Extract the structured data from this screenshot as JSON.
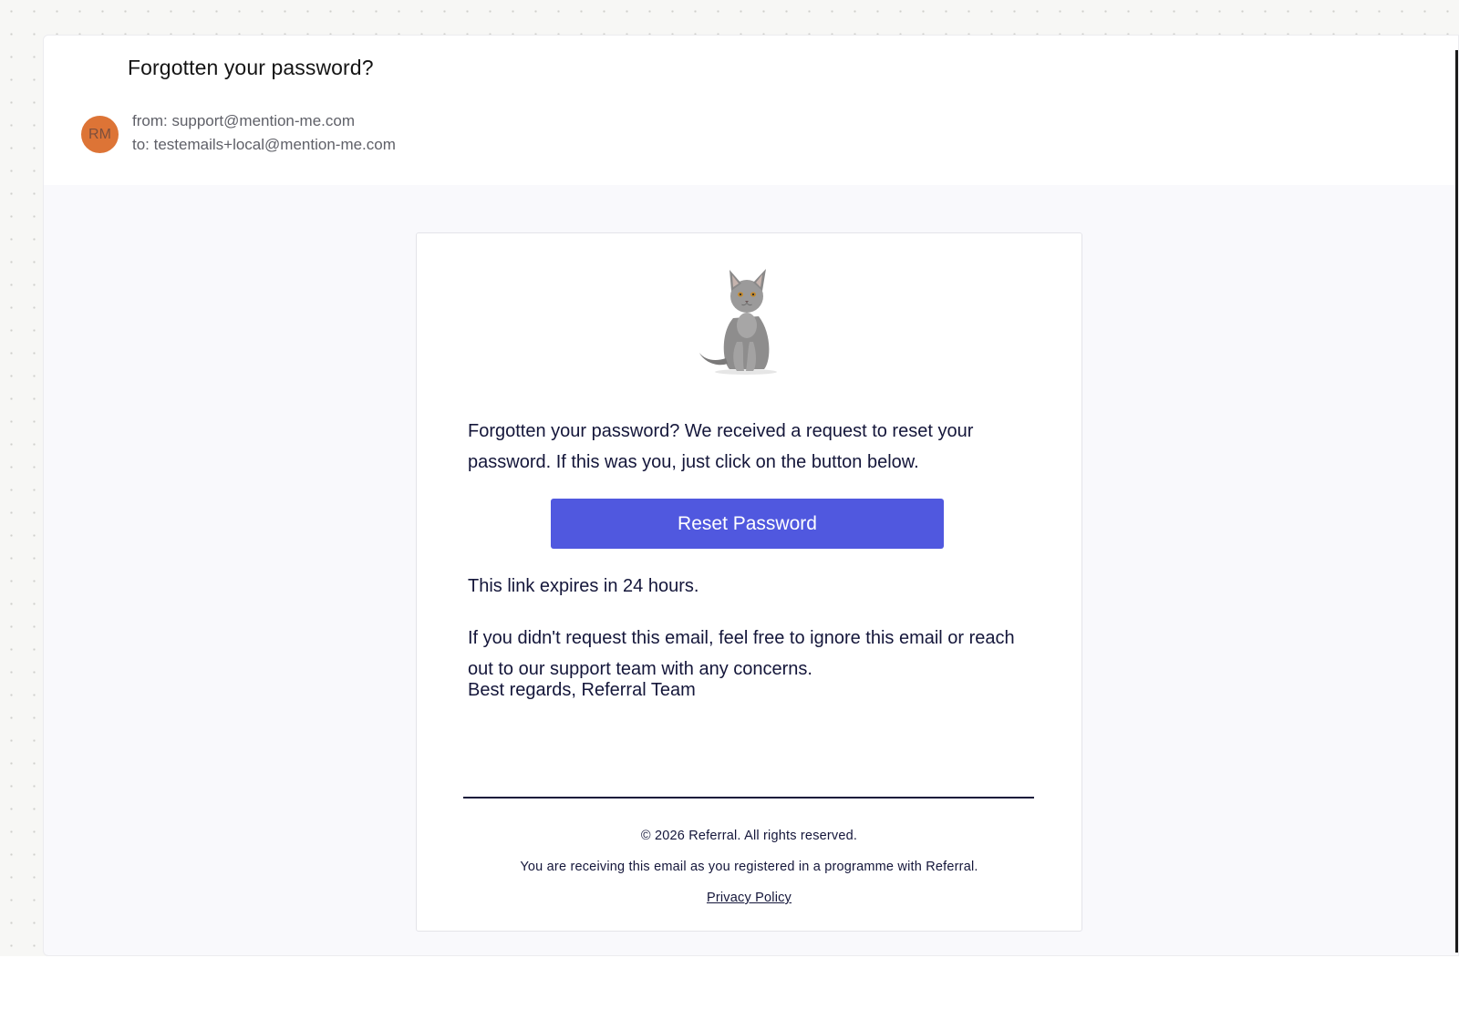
{
  "email": {
    "subject": "Forgotten your password?",
    "avatar_initials": "RM",
    "avatar_color": "#dd7436",
    "from_line": "from: support@mention-me.com",
    "to_line": "to: testemails+local@mention-me.com"
  },
  "message": {
    "image": "cat-illustration",
    "intro": "Forgotten your password? We received a request to reset your password. If this was you, just click on the button below.",
    "reset_button_label": "Reset Password",
    "button_color": "#5058df",
    "expiry_note": "This link expires in 24 hours.",
    "ignore_note": "If you didn't request this email, feel free to ignore this email or reach out to our support team with any concerns.",
    "sign_off": "Best regards, Referral Team"
  },
  "footer": {
    "copyright": "© 2026 Referral. All rights reserved.",
    "reason": "You are receiving this email as you registered in a programme with Referral.",
    "privacy_link": "Privacy Policy"
  }
}
